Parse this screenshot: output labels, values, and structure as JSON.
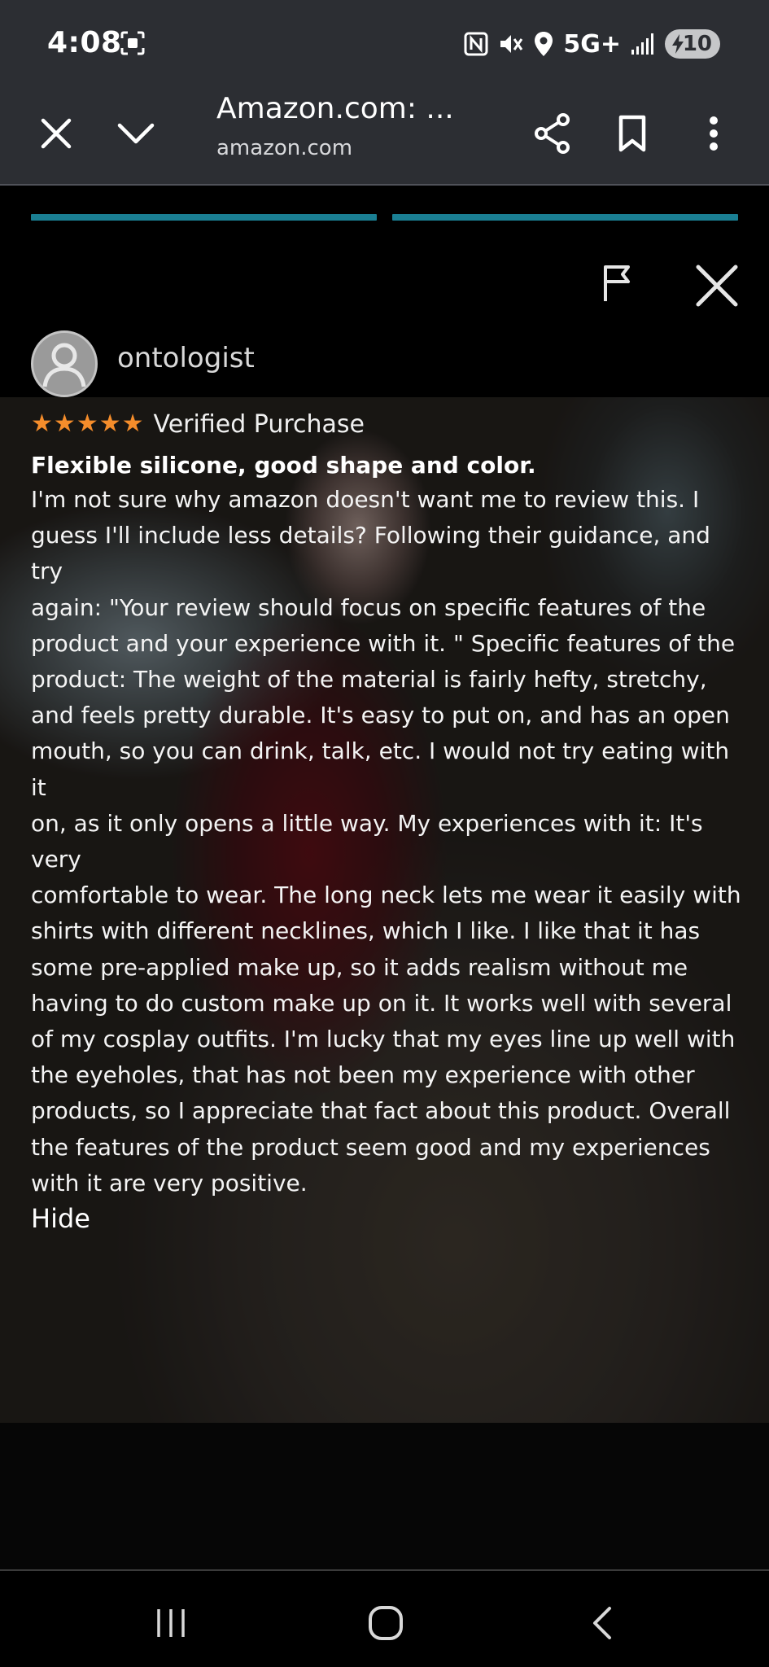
{
  "status_bar": {
    "time": "4:08",
    "network": "5G+",
    "battery": "10",
    "icons": [
      "screen-record-icon",
      "nfc-icon",
      "mute-icon",
      "location-icon",
      "signal-icon",
      "battery-charging-icon"
    ]
  },
  "browser": {
    "title": "Amazon.com: ...",
    "url": "amazon.com",
    "icons": [
      "close-icon",
      "chevron-down-icon",
      "share-icon",
      "bookmark-icon",
      "more-vert-icon"
    ]
  },
  "story_progress": {
    "segments": 2
  },
  "review": {
    "username": "ontologist",
    "rating": 5,
    "rating_max": 5,
    "verified_label": "Verified Purchase",
    "title": "Flexible silicone, good shape and color.",
    "body_lines": [
      "I'm not sure why amazon doesn't want me to review this. I",
      "guess I'll include less details? Following their guidance, and try",
      "again: \"Your review should focus on specific features of the",
      "product and your experience with it. \" Specific features of the",
      "product: The weight of the material is fairly hefty, stretchy,",
      "and feels pretty durable. It's easy to put on, and has an open",
      "mouth, so you can drink, talk, etc. I would not try eating with it",
      "on, as it only opens a little way. My experiences with it: It's very",
      "comfortable to wear. The long neck lets me wear it easily with",
      "shirts with different necklines, which I like. I like that it has",
      "some pre-applied make up, so it adds realism without me",
      "having to do custom make up on it. It works well with several",
      "of my cosplay outfits. I'm lucky that my eyes line up well with",
      "the eyeholes, that has not been my experience with other",
      "products, so I appreciate that fact about this product. Overall",
      "the features of the product seem good and my experiences",
      "with it are very positive."
    ],
    "hide_label": "Hide"
  },
  "colors": {
    "accent_progress": "#1a7f93",
    "star": "#f58d2b",
    "toolbar_bg": "#2c2e33"
  }
}
